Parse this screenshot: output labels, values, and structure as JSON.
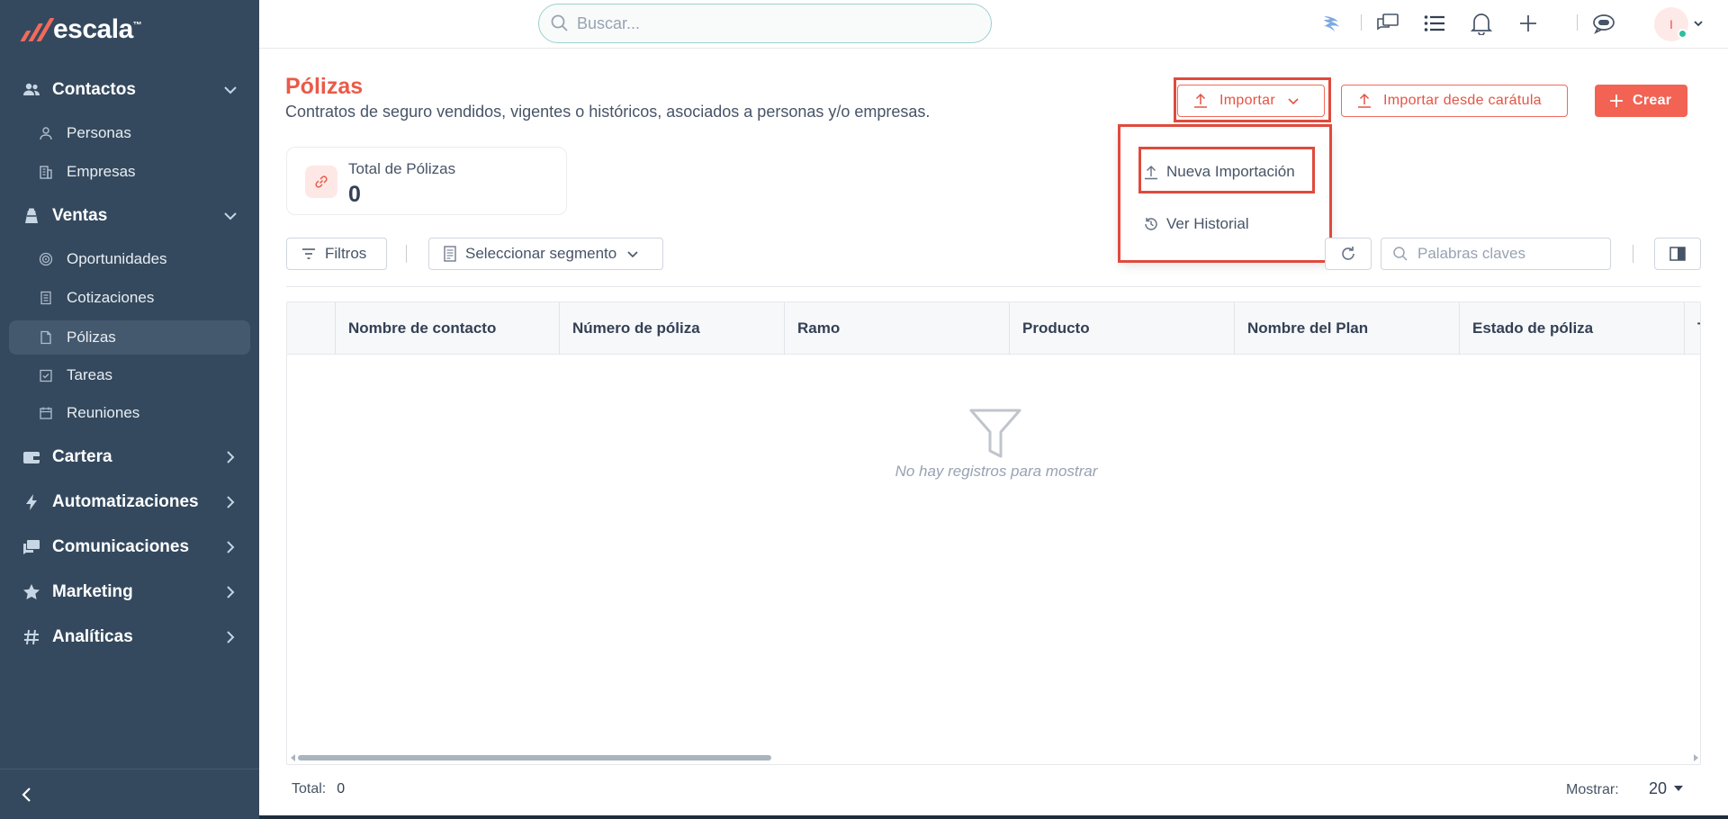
{
  "brand": {
    "name": "escala",
    "tm": "™",
    "accent": "#f26a5b",
    "sidebar_bg": "#34495e"
  },
  "sidebar": {
    "sections": [
      {
        "label": "Contactos",
        "icon": "people-icon",
        "expanded": true,
        "items": [
          {
            "label": "Personas",
            "icon": "person-icon"
          },
          {
            "label": "Empresas",
            "icon": "building-icon"
          }
        ]
      },
      {
        "label": "Ventas",
        "icon": "briefcase-icon",
        "expanded": true,
        "items": [
          {
            "label": "Oportunidades",
            "icon": "target-icon"
          },
          {
            "label": "Cotizaciones",
            "icon": "document-icon"
          },
          {
            "label": "Pólizas",
            "icon": "file-icon",
            "active": true
          },
          {
            "label": "Tareas",
            "icon": "checkbox-icon"
          },
          {
            "label": "Reuniones",
            "icon": "calendar-icon"
          }
        ]
      },
      {
        "label": "Cartera",
        "icon": "wallet-icon",
        "expanded": false
      },
      {
        "label": "Automatizaciones",
        "icon": "bolt-icon",
        "expanded": false
      },
      {
        "label": "Comunicaciones",
        "icon": "chat-icon",
        "expanded": false
      },
      {
        "label": "Marketing",
        "icon": "star-icon",
        "expanded": false
      },
      {
        "label": "Analíticas",
        "icon": "hash-icon",
        "expanded": false
      }
    ]
  },
  "topbar": {
    "search_placeholder": "Buscar...",
    "avatar_initial": "I"
  },
  "page": {
    "title": "Pólizas",
    "subtitle": "Contratos de seguro vendidos, vigentes o históricos, asociados a personas y/o empresas."
  },
  "actions": {
    "import_label": "Importar",
    "import_cover_label": "Importar desde carátula",
    "create_label": "Crear"
  },
  "import_menu": {
    "items": [
      {
        "label": "Nueva Importación",
        "icon": "upload-icon"
      },
      {
        "label": "Ver Historial",
        "icon": "history-icon"
      }
    ]
  },
  "stats": {
    "label": "Total de Pólizas",
    "value": "0"
  },
  "filters": {
    "filter_label": "Filtros",
    "segment_label": "Seleccionar segmento",
    "keywords_placeholder": "Palabras claves"
  },
  "table": {
    "columns": [
      "Nombre de contacto",
      "Número de póliza",
      "Ramo",
      "Producto",
      "Nombre del Plan",
      "Estado de póliza",
      "T"
    ],
    "empty_message": "No hay registros para mostrar"
  },
  "footer": {
    "total_label": "Total:",
    "total_value": "0",
    "show_label": "Mostrar:",
    "show_value": "20"
  }
}
